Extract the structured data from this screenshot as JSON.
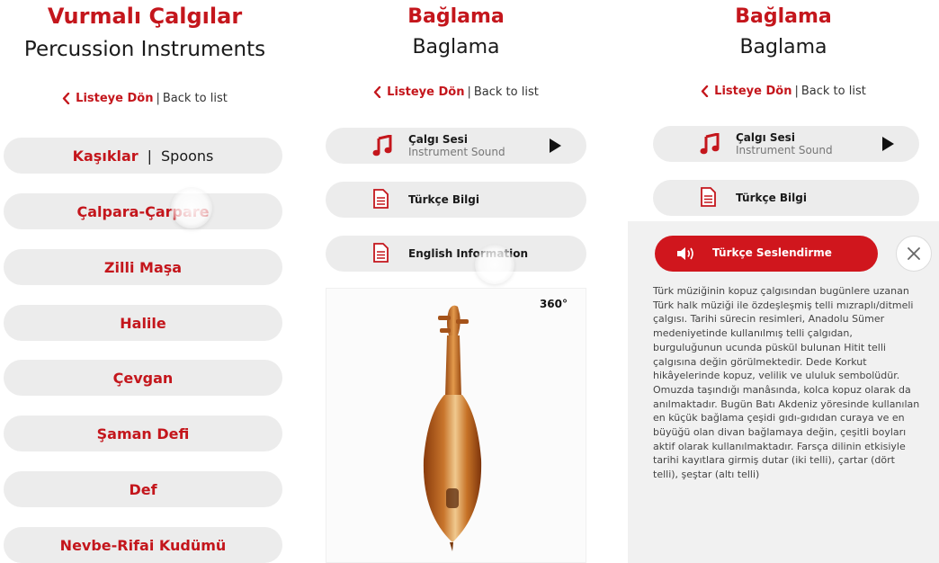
{
  "colors": {
    "brand_red": "#c4161c",
    "pill_gray": "#ececec",
    "overlay_gray": "#f1f1f1"
  },
  "panel1": {
    "title_tr": "Vurmalı Çalgılar",
    "title_en": "Percussion Instruments",
    "back": {
      "tr": "Listeye Dön",
      "sep": "|",
      "en": "Back to list"
    },
    "items": [
      {
        "tr": "Kaşıklar",
        "sep": "|",
        "en": "Spoons"
      },
      {
        "tr": "Çalpara-Çarpare"
      },
      {
        "tr": "Zilli Maşa"
      },
      {
        "tr": "Halile"
      },
      {
        "tr": "Çevgan"
      },
      {
        "tr": "Şaman Defi"
      },
      {
        "tr": "Def"
      },
      {
        "tr": "Nevbe-Rifai Kudümü"
      }
    ]
  },
  "panel2": {
    "title_tr": "Bağlama",
    "title_en": "Baglama",
    "back": {
      "tr": "Listeye Dön",
      "sep": "|",
      "en": "Back to list"
    },
    "sound": {
      "label": "Çalgı Sesi",
      "sub": "Instrument Sound",
      "icon": "music-note-icon",
      "action_icon": "play-icon"
    },
    "turkish_info": {
      "label": "Türkçe Bilgi",
      "icon": "document-icon"
    },
    "english_info": {
      "label": "English Information",
      "icon": "document-icon"
    },
    "badge": "360°"
  },
  "panel3": {
    "title_tr": "Bağlama",
    "title_en": "Baglama",
    "back": {
      "tr": "Listeye Dön",
      "sep": "|",
      "en": "Back to list"
    },
    "sound": {
      "label": "Çalgı Sesi",
      "sub": "Instrument Sound"
    },
    "turkish_info": {
      "label": "Türkçe Bilgi"
    },
    "speak_button": "Türkçe Seslendirme",
    "info_text": "Türk müziğinin kopuz çalgısından bugünlere uzanan Türk halk müziği ile özdeşleşmiş telli mızraplı/ditmeli çalgısı. Tarihi sürecin resimleri, Anadolu Sümer medeniyetinde kullanılmış telli çalgıdan, burguluğunun ucunda püskül bulunan Hitit telli çalgısına değin görülmektedir. Dede Korkut hikâyelerinde kopuz, velilik ve ululuk sembolüdür. Omuzda taşındığı manâsında, kolca kopuz olarak da anılmaktadır. Bugün Batı Akdeniz yöresinde kullanılan en küçük bağlama çeşidi gıdı-gıdıdan curaya ve en büyüğü olan divan bağlamaya değin, çeşitli boyları aktif olarak kullanılmaktadır. Farsça dilinin etkisiyle tarihi kayıtlara girmiş dutar (iki telli), çartar (dört telli), şeştar (altı telli)"
  }
}
